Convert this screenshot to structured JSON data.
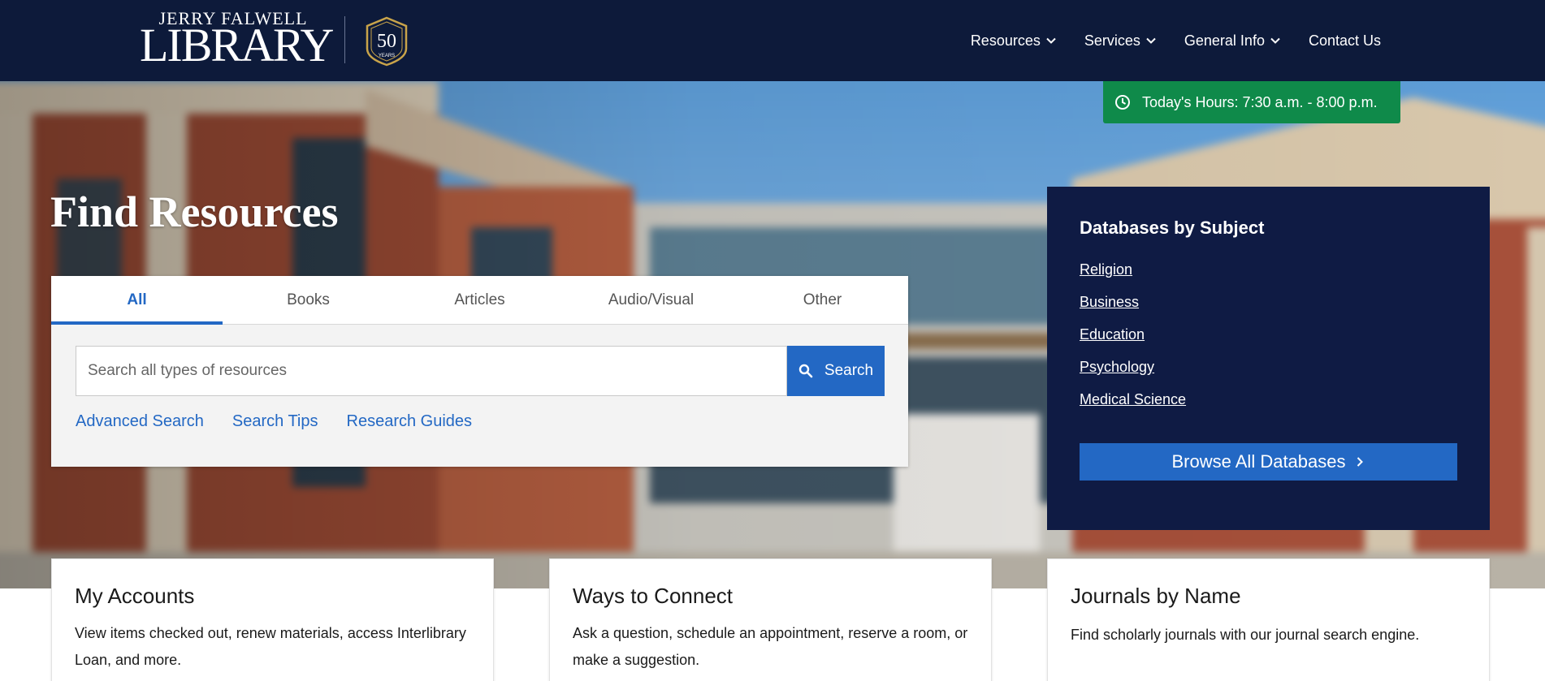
{
  "header": {
    "logo": {
      "top_text": "JERRY FALWELL",
      "main_text": "LIBRARY",
      "seal_number": "50",
      "seal_text": "YEARS"
    },
    "nav": [
      {
        "label": "Resources",
        "has_dropdown": true
      },
      {
        "label": "Services",
        "has_dropdown": true
      },
      {
        "label": "General Info",
        "has_dropdown": true
      },
      {
        "label": "Contact Us",
        "has_dropdown": false
      }
    ]
  },
  "hours": {
    "label": "Today's Hours: 7:30 a.m. - 8:00 p.m.",
    "icon": "clock-icon"
  },
  "find": {
    "title": "Find Resources",
    "tabs": [
      {
        "label": "All",
        "active": true
      },
      {
        "label": "Books",
        "active": false
      },
      {
        "label": "Articles",
        "active": false
      },
      {
        "label": "Audio/Visual",
        "active": false
      },
      {
        "label": "Other",
        "active": false
      }
    ],
    "search": {
      "placeholder": "Search all types of resources",
      "value": "",
      "button_label": "Search",
      "button_icon": "search-icon"
    },
    "links": [
      {
        "label": "Advanced Search"
      },
      {
        "label": "Search Tips"
      },
      {
        "label": "Research Guides"
      }
    ]
  },
  "databases": {
    "title": "Databases by Subject",
    "subjects": [
      {
        "label": "Religion"
      },
      {
        "label": "Business"
      },
      {
        "label": "Education"
      },
      {
        "label": "Psychology"
      },
      {
        "label": "Medical Science"
      }
    ],
    "browse_label": "Browse All Databases",
    "browse_icon": "chevron-right-icon"
  },
  "cards": [
    {
      "title": "My Accounts",
      "body": "View items checked out, renew materials, access Interlibrary Loan, and more."
    },
    {
      "title": "Ways to Connect",
      "body": "Ask a question, schedule an appointment, reserve a room, or make a suggestion."
    },
    {
      "title": "Journals by Name",
      "body": "Find scholarly journals with our journal search engine."
    }
  ],
  "colors": {
    "header_bg": "#0d1a3a",
    "accent_blue": "#2368c4",
    "hours_green": "#0f8a4a",
    "db_panel_bg": "#0f1b44",
    "panel_gray": "#f3f3f3"
  }
}
